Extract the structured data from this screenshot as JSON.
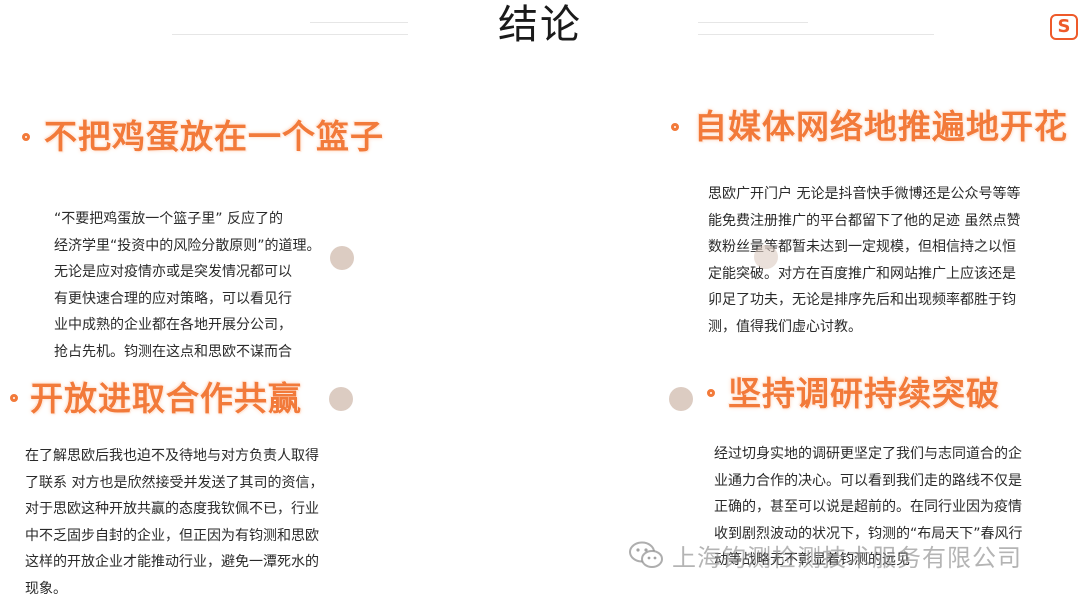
{
  "page": {
    "title": "结论"
  },
  "badge": {
    "text": "S"
  },
  "sections": [
    {
      "heading": "不把鸡蛋放在一个篮子",
      "lines": [
        "  “不要把鸡蛋放一个篮子里” 反应了的",
        "经济学里“投资中的风险分散原则”的道理。",
        "无论是应对疫情亦或是突发情况都可以",
        "有更快速合理的应对策略，可以看见行",
        "业中成熟的企业都在各地开展分公司，",
        "抢占先机。钧测在这点和思欧不谋而合"
      ]
    },
    {
      "heading": "自媒体网络地推遍地开花",
      "lines": [
        "思欧广开门户 无论是抖音快手微博还是公众号等等",
        "能免费注册推广的平台都留下了他的足迹 虽然点赞",
        "数粉丝量等都暂未达到一定规模，但相信持之以恒",
        "定能突破。对方在百度推广和网站推广上应该还是",
        "卯足了功夫，无论是排序先后和出现频率都胜于钧",
        "测，值得我们虚心讨教。"
      ]
    },
    {
      "heading": "开放进取合作共赢",
      "lines": [
        "在了解思欧后我也迫不及待地与对方负责人取得",
        "了联系 对方也是欣然接受并发送了其司的资信，",
        "对于思欧这种开放共赢的态度我钦佩不已，行业",
        "中不乏固步自封的企业，但正因为有钧测和思欧",
        "这样的开放企业才能推动行业，避免一潭死水的",
        "现象。"
      ]
    },
    {
      "heading": "坚持调研持续突破",
      "lines": [
        "经过切身实地的调研更坚定了我们与志同道合的企",
        "业通力合作的决心。可以看到我们走的路线不仅是",
        "正确的，甚至可以说是超前的。在同行业因为疫情",
        "收到剧烈波动的状况下，钧测的“布局天下”春风行",
        "动等战略无不彰显着钧测的远见"
      ]
    }
  ],
  "watermark": {
    "text": "上海钧测检测技术服务有限公司"
  }
}
